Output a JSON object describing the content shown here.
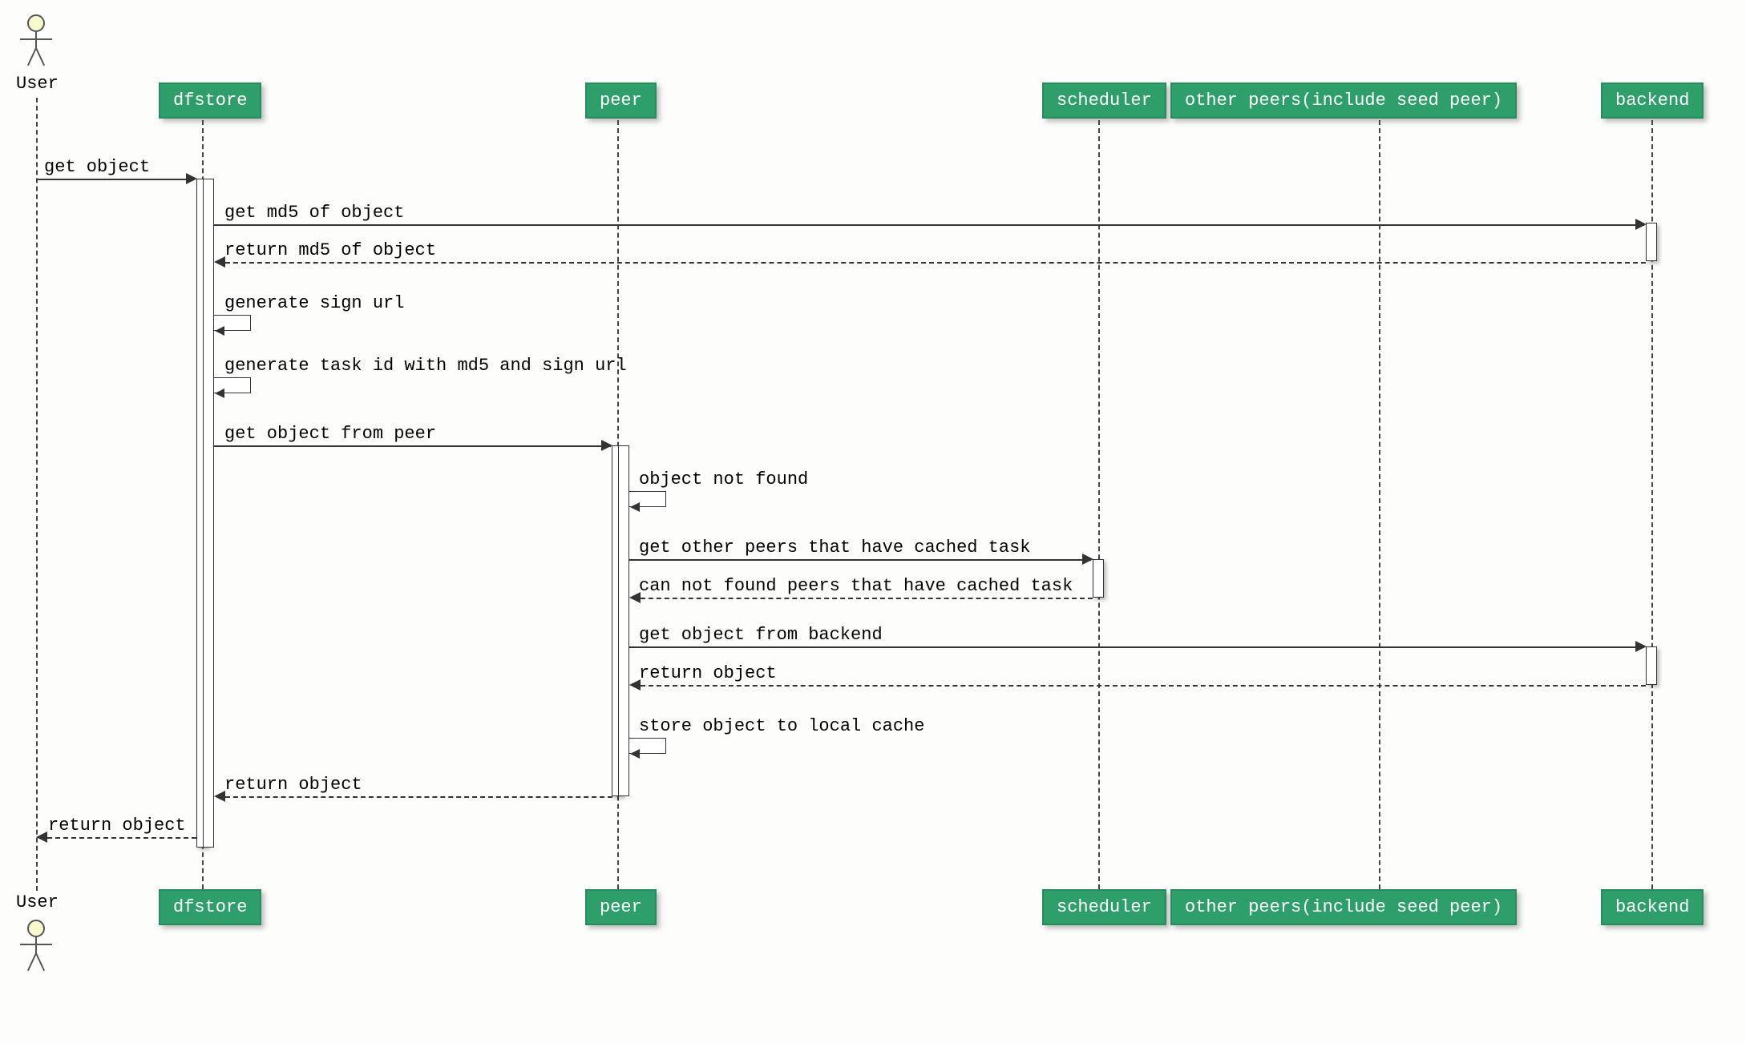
{
  "diagram_type": "sequence",
  "participants": {
    "user": "User",
    "dfstore": "dfstore",
    "peer": "peer",
    "scheduler": "scheduler",
    "other_peers": "other peers(include seed peer)",
    "backend": "backend"
  },
  "messages": {
    "m1": "get object",
    "m2": "get md5 of object",
    "m3": "return md5 of object",
    "m4": "generate sign url",
    "m5": "generate task id with md5 and sign url",
    "m6": "get object from peer",
    "m7": "object not found",
    "m8": "get other peers that have cached task",
    "m9": "can not found peers that have cached task",
    "m10": "get object from backend",
    "m11": "return object",
    "m12": "store object to local cache",
    "m13": "return object",
    "m14": "return object"
  },
  "lane_x": {
    "user": 45,
    "dfstore": 252,
    "peer": 770,
    "scheduler": 1370,
    "other_peers": 1720,
    "backend": 2060
  }
}
